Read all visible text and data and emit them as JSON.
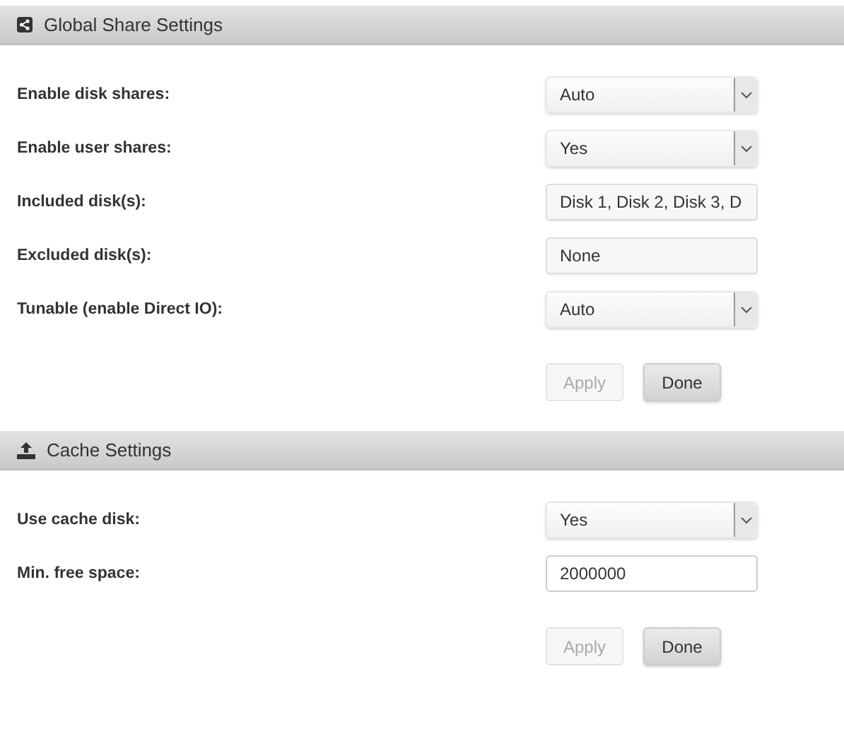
{
  "sections": [
    {
      "title": "Global Share Settings",
      "kind": "share",
      "rows": [
        {
          "label": "Enable disk shares:",
          "kind": "select",
          "value": "Auto"
        },
        {
          "label": "Enable user shares:",
          "kind": "select",
          "value": "Yes"
        },
        {
          "label": "Included disk(s):",
          "kind": "list",
          "value": "Disk 1, Disk 2, Disk 3, D"
        },
        {
          "label": "Excluded disk(s):",
          "kind": "list",
          "value": "None"
        },
        {
          "label": "Tunable (enable Direct IO):",
          "kind": "select",
          "value": "Auto"
        }
      ],
      "buttons": [
        {
          "label": "Apply",
          "disabled": true
        },
        {
          "label": "Done",
          "disabled": false
        }
      ]
    },
    {
      "title": "Cache Settings",
      "kind": "upload",
      "rows": [
        {
          "label": "Use cache disk:",
          "kind": "select",
          "value": "Yes"
        },
        {
          "label": "Min. free space:",
          "kind": "text",
          "value": "2000000"
        }
      ],
      "buttons": [
        {
          "label": "Apply",
          "disabled": true
        },
        {
          "label": "Done",
          "disabled": false
        }
      ]
    }
  ]
}
